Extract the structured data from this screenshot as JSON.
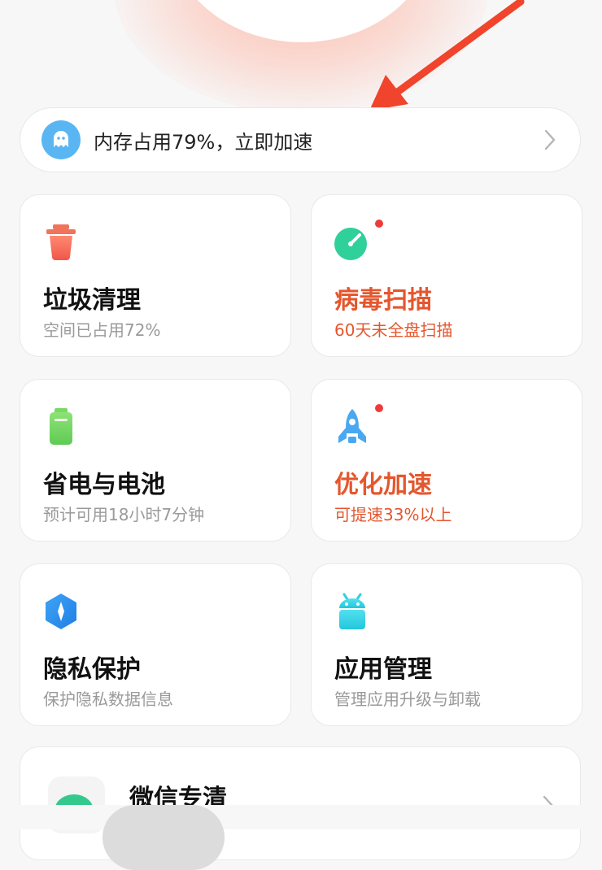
{
  "banner": {
    "text": "内存占用79%，立即加速",
    "icon": "ghost-icon",
    "chevron": "chevron-right-icon"
  },
  "cards": [
    {
      "title": "垃圾清理",
      "subtitle": "空间已占用72%",
      "icon": "trash-icon",
      "alert": false,
      "badge": false
    },
    {
      "title": "病毒扫描",
      "subtitle": "60天未全盘扫描",
      "icon": "virus-scan-icon",
      "alert": true,
      "badge": true
    },
    {
      "title": "省电与电池",
      "subtitle": "预计可用18小时7分钟",
      "icon": "battery-icon",
      "alert": false,
      "badge": false
    },
    {
      "title": "优化加速",
      "subtitle": "可提速33%以上",
      "icon": "rocket-icon",
      "alert": true,
      "badge": true
    },
    {
      "title": "隐私保护",
      "subtitle": "保护隐私数据信息",
      "icon": "privacy-shield-icon",
      "alert": false,
      "badge": false
    },
    {
      "title": "应用管理",
      "subtitle": "管理应用升级与卸载",
      "icon": "android-app-icon",
      "alert": false,
      "badge": false
    }
  ],
  "wechat": {
    "title": "微信专清",
    "icon": "wechat-clean-icon"
  },
  "colors": {
    "alert": "#e4572e",
    "badge": "#ee3b3b",
    "arrow": "#f0442c"
  }
}
